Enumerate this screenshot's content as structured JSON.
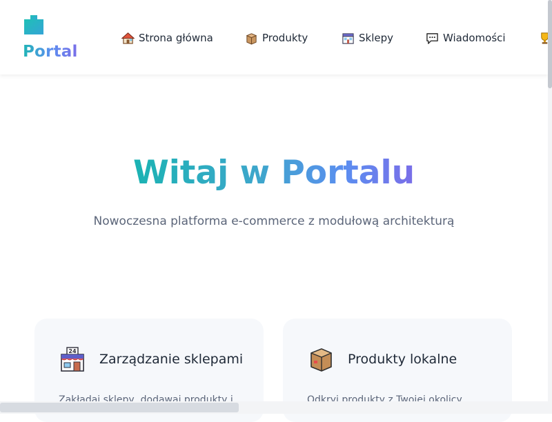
{
  "header": {
    "logo_text": "Portal",
    "nav": [
      {
        "label": "Strona główna",
        "icon": "house-icon"
      },
      {
        "label": "Produkty",
        "icon": "package-icon"
      },
      {
        "label": "Sklepy",
        "icon": "store-icon"
      },
      {
        "label": "Wiadomości",
        "icon": "chat-icon"
      },
      {
        "label": "",
        "icon": "trophy-icon"
      }
    ]
  },
  "hero": {
    "title": "Witaj w Portalu",
    "subtitle": "Nowoczesna platforma e-commerce z modułową architekturą"
  },
  "features": [
    {
      "title": "Zarządzanie sklepami",
      "text": "Zakładaj sklepy, dodawaj produkty i",
      "icon": "store-24-icon"
    },
    {
      "title": "Produkty lokalne",
      "text": "Odkryj produkty z Twojej okolicy",
      "icon": "package-icon"
    }
  ],
  "colors": {
    "gradient_start": "#1bb3b3",
    "gradient_mid": "#5b8ef0",
    "gradient_end": "#7a6ee8",
    "card_background": "#f6f8fb",
    "subtitle_text": "#5b6579"
  }
}
